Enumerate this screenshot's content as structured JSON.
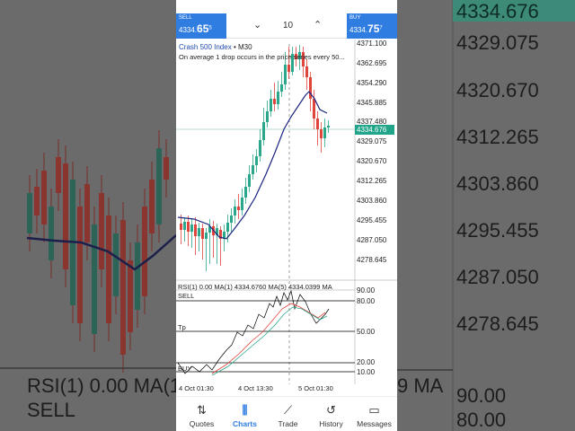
{
  "trade_bar": {
    "sell_label": "SELL",
    "sell_price_main": "4334.",
    "sell_price_big": "65",
    "sell_price_sup": "5",
    "buy_label": "BUY",
    "buy_price_main": "4334.",
    "buy_price_big": "75",
    "buy_price_sup": "7",
    "lot_value": "10",
    "lot_down_icon": "chevron-down-icon",
    "lot_up_icon": "chevron-up-icon"
  },
  "chart": {
    "symbol": "Crash 500 Index",
    "timeframe": "• M30",
    "note": "On average 1 drop occurs in the price series every 50...",
    "price_labels": [
      "4371.100",
      "4362.695",
      "4354.290",
      "4345.885",
      "4337.480",
      "4329.075",
      "4320.670",
      "4312.265",
      "4303.860",
      "4295.455",
      "4287.050",
      "4278.645"
    ],
    "current_price": "4334.676",
    "rsi_title": "RSI(1) 0.00 MA(1) 4334.6760 MA(5) 4334.0399 MA",
    "rsi_levels": [
      "90.00",
      "80.00",
      "50.00",
      "20.00",
      "10.00"
    ],
    "rsi_sell": "SELL",
    "rsi_tp": "Tp",
    "rsi_buy": "BUY",
    "x_labels": [
      "4 Oct 01:30",
      "4 Oct 13:30",
      "5 Oct 01:30"
    ],
    "colors": {
      "up": "#2aa68b",
      "down": "#e0453c",
      "ma": "#1a237e",
      "accent": "#2f7de1"
    }
  },
  "background": {
    "right_prices": [
      "4334.676",
      "4329.075",
      "4320.670",
      "4312.265",
      "4303.860",
      "4295.455",
      "4287.050",
      "4278.645"
    ],
    "right_rsi": [
      "90.00",
      "80.00"
    ],
    "left_rsi_title": "RSI(1) 0.00 MA(1",
    "left_sell": "SELL",
    "right_rsi_tail": "9 MA"
  },
  "nav": [
    {
      "label": "Quotes",
      "icon": "quotes-icon",
      "glyph": "⇅"
    },
    {
      "label": "Charts",
      "icon": "charts-icon",
      "glyph": "⫼"
    },
    {
      "label": "Trade",
      "icon": "trade-icon",
      "glyph": "⟋"
    },
    {
      "label": "History",
      "icon": "history-icon",
      "glyph": "↺"
    },
    {
      "label": "Messages",
      "icon": "messages-icon",
      "glyph": "▭"
    }
  ]
}
